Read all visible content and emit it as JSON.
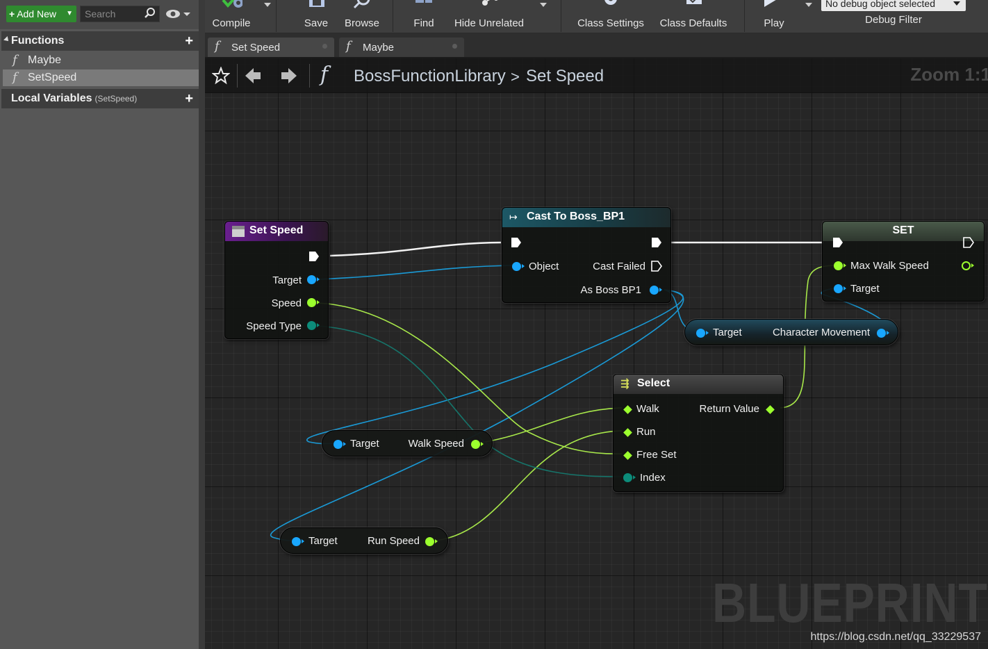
{
  "left_panel": {
    "add_new_label": "Add New",
    "search_placeholder": "Search",
    "functions_title": "Functions",
    "functions": [
      {
        "label": "Maybe"
      },
      {
        "label": "SetSpeed"
      }
    ],
    "function_glyph": "f",
    "local_vars_title": "Local Variables",
    "local_vars_scope": "(SetSpeed)",
    "add_glyph": "+"
  },
  "toolbar": {
    "compile": "Compile",
    "save": "Save",
    "browse": "Browse",
    "find": "Find",
    "hide_unrelated": "Hide Unrelated",
    "class_settings": "Class Settings",
    "class_defaults": "Class Defaults",
    "play": "Play",
    "debug_selected": "No debug object selected",
    "debug_filter": "Debug Filter"
  },
  "tabs": [
    {
      "label": "Set Speed",
      "active": true
    },
    {
      "label": "Maybe",
      "active": false
    }
  ],
  "breadcrumb": {
    "library": "BossFunctionLibrary",
    "separator": ">",
    "function": "Set Speed",
    "zoom": "Zoom 1:1"
  },
  "nodes": {
    "set_speed": {
      "title": "Set Speed",
      "pins": {
        "target": "Target",
        "speed": "Speed",
        "speed_type": "Speed Type"
      }
    },
    "cast": {
      "title": "Cast To Boss_BP1",
      "pins": {
        "object": "Object",
        "cast_failed": "Cast Failed",
        "as_boss": "As Boss BP1"
      }
    },
    "set": {
      "title": "SET",
      "pins": {
        "max_walk_speed": "Max Walk Speed",
        "target": "Target"
      }
    },
    "char_movement": {
      "target": "Target",
      "output": "Character Movement"
    },
    "select": {
      "title": "Select",
      "pins": {
        "walk": "Walk",
        "run": "Run",
        "free_set": "Free Set",
        "index": "Index",
        "return_value": "Return Value"
      }
    },
    "walk_speed": {
      "target": "Target",
      "output": "Walk Speed"
    },
    "run_speed": {
      "target": "Target",
      "output": "Run Speed"
    }
  },
  "watermark": "BLUEPRINT",
  "credit": "https://blog.csdn.net/qq_33229537",
  "colors": {
    "add_new": "#2f8a2f",
    "object_pin": "#19a7ff",
    "float_pin": "#9cff2e",
    "enum_pin": "#0c8c7a",
    "function_header": "#5b1f7a",
    "cast_header": "#1f4f5a",
    "set_header": "#3b4a3b",
    "select_header": "#4a4a4a"
  }
}
